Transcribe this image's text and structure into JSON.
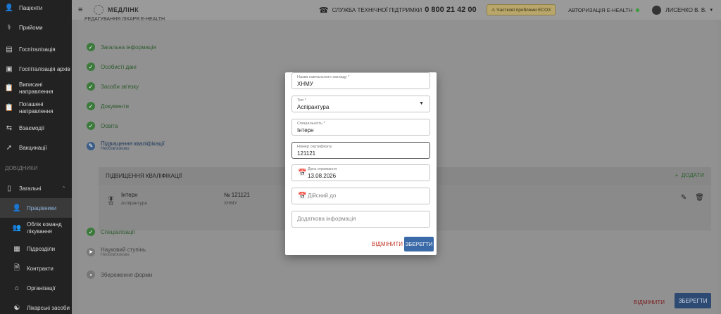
{
  "sidebar": {
    "items": [
      {
        "label": "Пацієнти",
        "icon": "user-icon"
      },
      {
        "label": "Прийоми",
        "icon": "stethoscope-icon"
      },
      {
        "label": "Госпіталізація",
        "icon": "bed-icon"
      },
      {
        "label": "Госпіталізація архів",
        "icon": "archive-icon"
      },
      {
        "label": "Виписані направлення",
        "icon": "clipboard-icon"
      },
      {
        "label": "Погашені направлення",
        "icon": "clipboard-check-icon"
      },
      {
        "label": "Взаємодії",
        "icon": "swap-icon"
      },
      {
        "label": "Вакцинації",
        "icon": "syringe-icon"
      }
    ],
    "section_label": "ДОВІДНИКИ",
    "group": {
      "label": "Загальні",
      "icon": "phone-icon"
    },
    "sub_items": [
      {
        "label": "Працівники",
        "icon": "worker-icon",
        "active": true
      },
      {
        "label": "Облік команд лікування",
        "icon": "team-icon"
      },
      {
        "label": "Підрозділи",
        "icon": "department-icon"
      },
      {
        "label": "Контракти",
        "icon": "document-icon"
      },
      {
        "label": "Організації",
        "icon": "home-icon"
      },
      {
        "label": "Лікарські засоби",
        "icon": "pills-icon"
      }
    ]
  },
  "topbar": {
    "brand": "МЕДЛІНК",
    "support_label": "СЛУЖБА ТЕХНІЧНОЇ ПІДТРИМКИ",
    "support_phone": "0 800 21 42 00",
    "badge": "Часткові проблеми ЕСОЗ",
    "auth_label": "АВТОРИЗАЦІЯ E-HEALTH",
    "user_name": "ЛИСЕНКО В. В."
  },
  "page": {
    "title": "РЕДАГУВАННЯ ЛІКАРЯ E-HEALTH",
    "steps": [
      {
        "label": "Загальна інформація",
        "state": "done"
      },
      {
        "label": "Особисті дані",
        "state": "done"
      },
      {
        "label": "Засоби зв'язку",
        "state": "done"
      },
      {
        "label": "Документи",
        "state": "done"
      },
      {
        "label": "Освіта",
        "state": "done"
      },
      {
        "label": "Підвищення кваліфікації",
        "sub": "Необов'язково",
        "state": "edit"
      },
      {
        "label": "Спеціалізації",
        "state": "done"
      },
      {
        "label": "Науковий ступінь",
        "sub": "Необов'язково",
        "state": "pending"
      },
      {
        "label": "Збереження форми",
        "state": "pending"
      }
    ],
    "qualification": {
      "header": "ПІДВИЩЕННЯ КВАЛІФІКАЦІЇ",
      "add_label": "ДОДАТИ",
      "row": {
        "name": "Інтерн",
        "type": "Аспірантура",
        "number": "№ 121121",
        "institution": "ХНМУ"
      }
    },
    "cancel_label": "ВІДМІНИТИ",
    "save_label": "ЗБЕРЕГТИ"
  },
  "modal": {
    "fields": {
      "institution": {
        "label": "Назва навчального закладу *",
        "value": "ХНМУ"
      },
      "type": {
        "label": "Тип *",
        "value": "Аспірантура"
      },
      "speciality": {
        "label": "Спеціальність *",
        "value": "Інтерн"
      },
      "certificate": {
        "label": "Номер сертифікату",
        "value": "121121"
      },
      "issued": {
        "label": "Дата отримання",
        "value": "13.08.2026"
      },
      "valid_until": {
        "placeholder": "Дійсний до"
      },
      "extra": {
        "placeholder": "Додаткова інформація"
      }
    },
    "cancel_label": "ВІДМІНИТИ",
    "save_label": "ЗБЕРЕГТИ"
  }
}
